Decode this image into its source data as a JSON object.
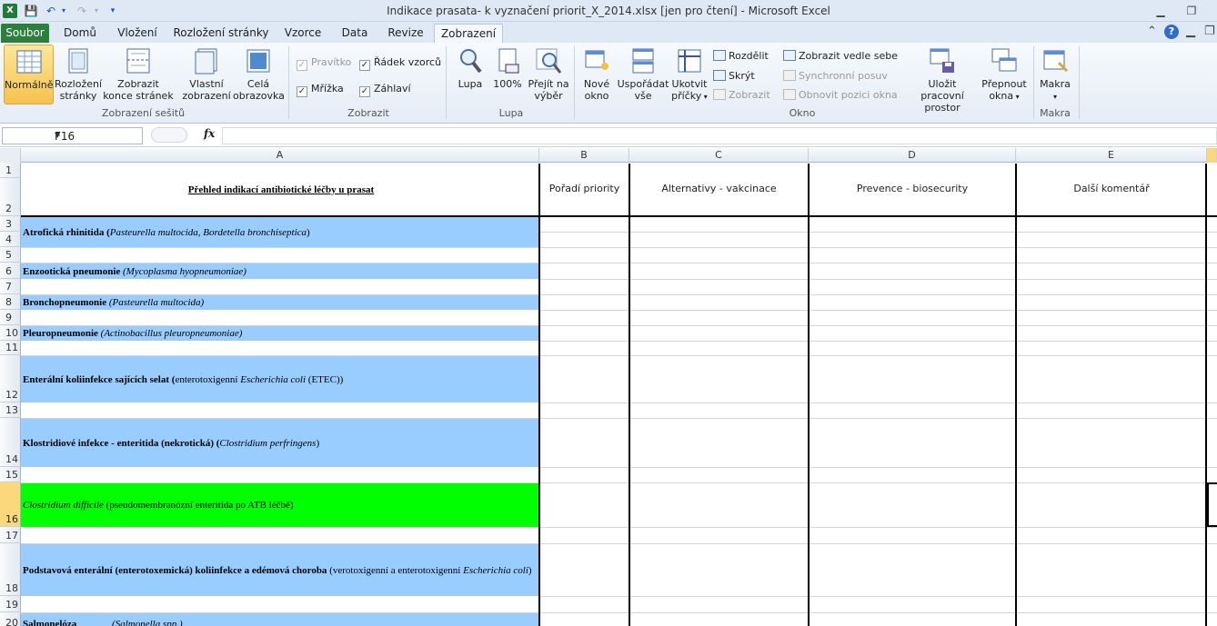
{
  "window": {
    "title": "Indikace prasata- k vyznačení priorit_X_2014.xlsx  [jen pro čtení]  -  Microsoft Excel",
    "app_icon": "X"
  },
  "tabs": [
    "Soubor",
    "Domů",
    "Vložení",
    "Rozložení stránky",
    "Vzorce",
    "Data",
    "Revize",
    "Zobrazení"
  ],
  "ribbon": {
    "workbook_views": {
      "group": "Zobrazení sešitů",
      "normal": "Normálně",
      "page_layout_1": "Rozložení",
      "page_layout_2": "stránky",
      "page_break_1": "Zobrazit",
      "page_break_2": "konce stránek",
      "custom_1": "Vlastní",
      "custom_2": "zobrazení",
      "full_1": "Celá",
      "full_2": "obrazovka"
    },
    "show": {
      "group": "Zobrazit",
      "ruler": "Pravítko",
      "formula_bar": "Řádek vzorců",
      "gridlines": "Mřížka",
      "headings": "Záhlaví"
    },
    "zoom": {
      "group": "Lupa",
      "zoom": "Lupa",
      "hundred": "100%",
      "to_sel_1": "Přejít na",
      "to_sel_2": "výběr"
    },
    "window": {
      "group": "Okno",
      "new_1": "Nové",
      "new_2": "okno",
      "arrange_1": "Uspořádat",
      "arrange_2": "vše",
      "freeze_1": "Ukotvit",
      "freeze_2": "příčky",
      "split": "Rozdělit",
      "hide": "Skrýt",
      "unhide": "Zobrazit",
      "side": "Zobrazit vedle sebe",
      "sync": "Synchronní posuv",
      "reset": "Obnovit pozici okna",
      "save_1": "Uložit pracovní",
      "save_2": "prostor",
      "switch_1": "Přepnout",
      "switch_2": "okna"
    },
    "macros": {
      "group": "Makra",
      "label": "Makra"
    }
  },
  "formula_bar": {
    "name_box": "F16",
    "fx": "fx",
    "value": ""
  },
  "columns": [
    "A",
    "B",
    "C",
    "D",
    "E"
  ],
  "header_row": {
    "A": "Přehled indikací antibiotické léčby u prasat",
    "B": "Pořadí priority",
    "C": "Alternativy - vakcinace",
    "D": "Prevence - biosecurity",
    "E": "Další komentář"
  },
  "rows": {
    "r3": {
      "bold": "Atrofická rhinitida (",
      "italic": "Pasteurella multocida, Bordetella bronchiseptica",
      "tail": ")"
    },
    "r6": {
      "bold": "Enzootická pneumonie ",
      "italic": "(Mycoplasma hyopneumoniae)",
      "tail": ""
    },
    "r8": {
      "bold": "Bronchopneumonie ",
      "italic": "(Pasteurella multocida)",
      "tail": ""
    },
    "r10": {
      "bold": "Pleuropneumonie ",
      "italic": "(Actinobacillus pleuropneumoniae)",
      "tail": ""
    },
    "r12": {
      "bold": "Enterální koliinfekce sajících selat (",
      "plain": "enterotoxigenní ",
      "italic": "Escherichia coli",
      "tail": "  (ETEC))"
    },
    "r14": {
      "bold": "Klostridiové infekce - enteritida (nekrotická) (",
      "italic": "Clostridium perfringens",
      "tail": ")"
    },
    "r16": {
      "italic": "Clostridium difficile",
      "tail": "  (pseudomembranózní enteritida po ATB léčbě)"
    },
    "r18": {
      "bold": "Podstavová enterální (enterotoxemická) koliinfekce a edémová choroba ",
      "plain": "(verotoxigenní a enterotoxigenní ",
      "italic": "Escherichia coli",
      "tail": ")"
    },
    "r20": {
      "bold": "Salmonelóza ",
      "italic": "(Salmonella spp.)",
      "tail": ""
    }
  },
  "row_numbers": [
    "1",
    "2",
    "3",
    "4",
    "5",
    "6",
    "7",
    "8",
    "9",
    "10",
    "11",
    "12",
    "13",
    "14",
    "15",
    "16",
    "17",
    "18",
    "19",
    "20"
  ],
  "colors": {
    "blue_fill": "#99ccff",
    "green_fill": "#00ff00",
    "active_row": "#fbd97a"
  }
}
